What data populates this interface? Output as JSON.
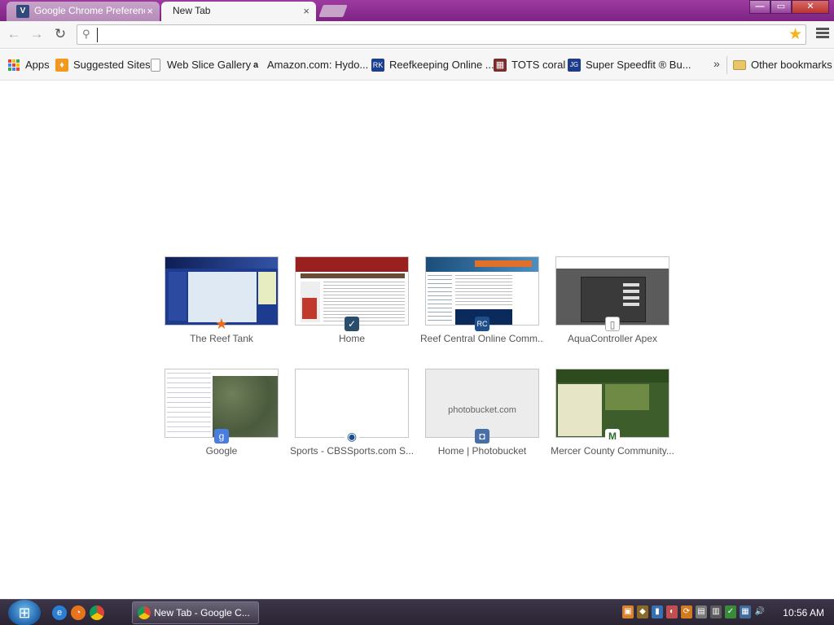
{
  "tabs": [
    {
      "title": "Google Chrome Preferences",
      "close": "×",
      "favicon": "V"
    },
    {
      "title": "New Tab",
      "close": "×"
    }
  ],
  "window_controls": {
    "minimize": "—",
    "maximize": "▭",
    "close": "✕"
  },
  "toolbar": {
    "back": "←",
    "forward": "→",
    "reload": "↻",
    "omnibox_value": "",
    "search_icon": "⚲",
    "star": "★"
  },
  "bookmarks": [
    {
      "label": "Apps",
      "icon": "apps-grid-icon"
    },
    {
      "label": "Suggested Sites",
      "icon": "suggested-sites-icon"
    },
    {
      "label": "Web Slice Gallery",
      "icon": "page-icon"
    },
    {
      "label": "Amazon.com: Hydo...",
      "icon": "amazon-icon"
    },
    {
      "label": "Reefkeeping Online ...",
      "icon": "reefkeeping-icon"
    },
    {
      "label": "TOTS coral",
      "icon": "tots-icon"
    },
    {
      "label": "Super Speedfit ® Bu...",
      "icon": "speedfit-icon"
    },
    {
      "label": "Other bookmarks",
      "icon": "folder-icon"
    }
  ],
  "bookmarks_more": "»",
  "most_visited": [
    {
      "title": "The Reef Tank",
      "icon": "★"
    },
    {
      "title": "Home",
      "icon": "✓"
    },
    {
      "title": "Reef Central Online Comm...",
      "icon": "RC"
    },
    {
      "title": "AquaController Apex",
      "icon": "▯"
    },
    {
      "title": "Google",
      "icon": "g"
    },
    {
      "title": "Sports - CBSSports.com S...",
      "icon": "◉"
    },
    {
      "title": "Home | Photobucket",
      "icon": "◘",
      "thumb_text": "photobucket.com"
    },
    {
      "title": "Mercer County Community...",
      "icon": "M"
    }
  ],
  "taskbar": {
    "start": "⊞",
    "task_label": "New Tab - Google C...",
    "clock": "10:56 AM"
  }
}
